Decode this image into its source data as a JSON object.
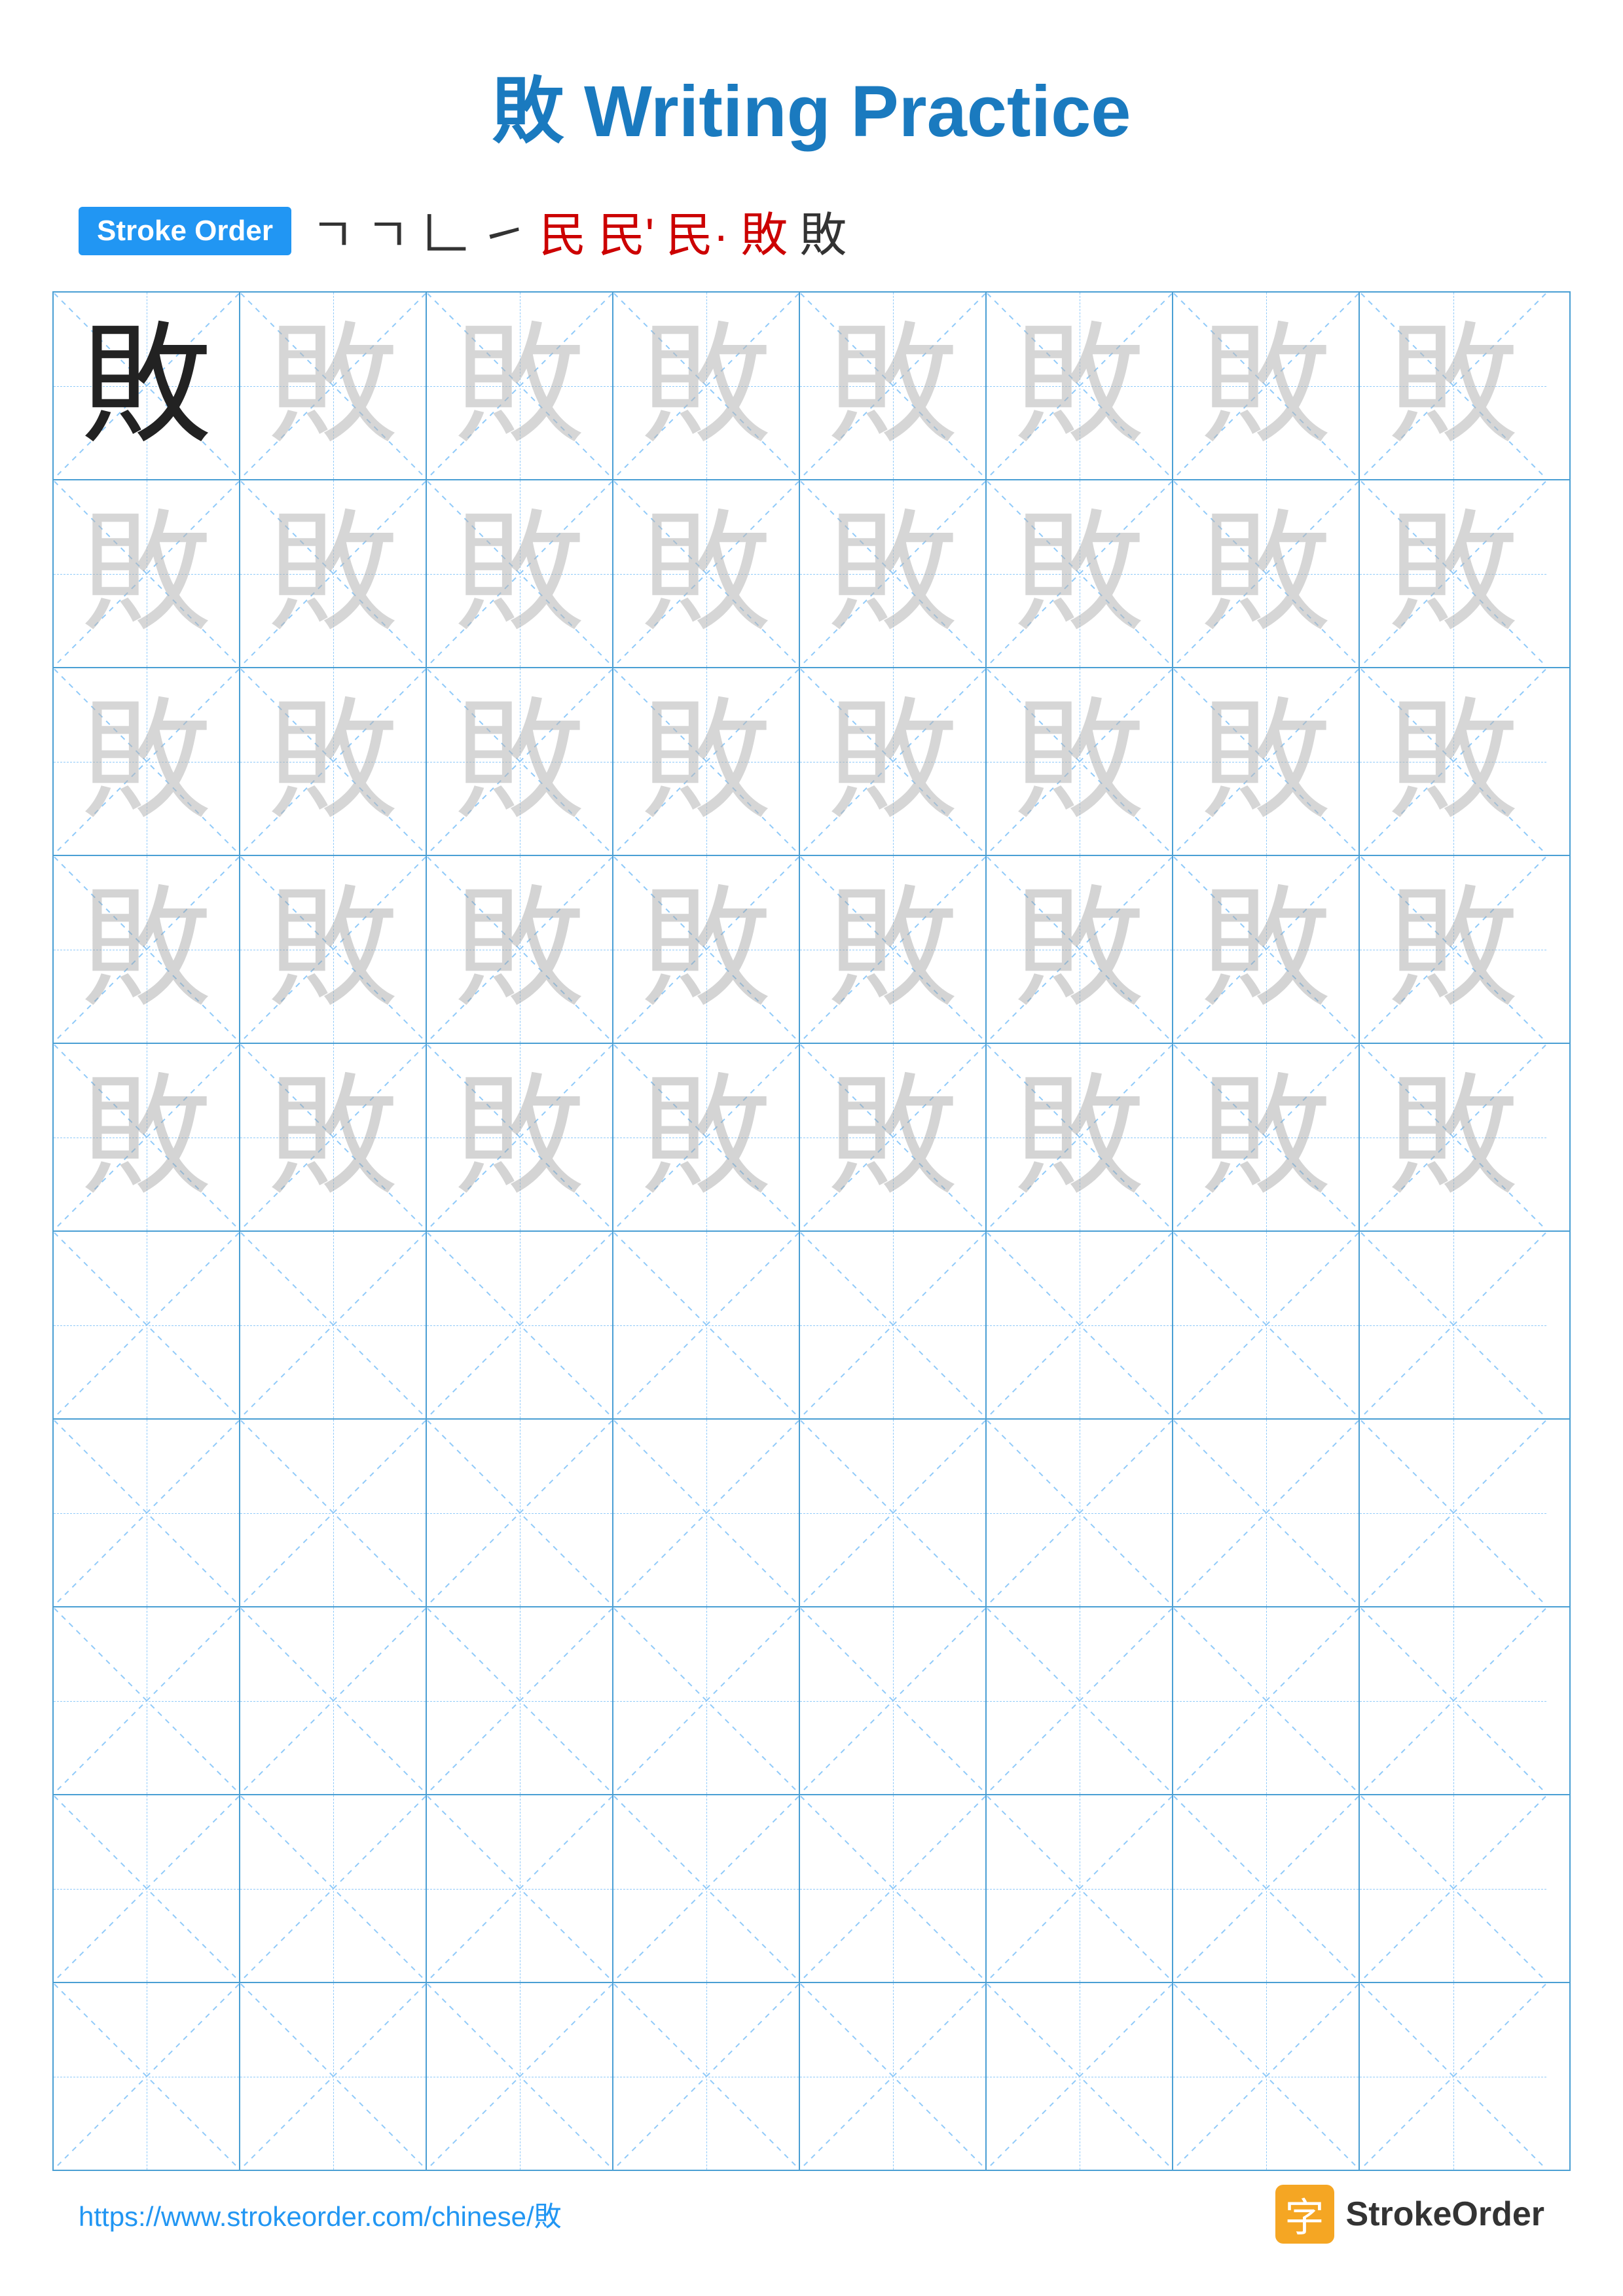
{
  "page": {
    "title": "敗 Writing Practice",
    "title_char": "敗",
    "title_text": " Writing Practice"
  },
  "stroke_order": {
    "badge_label": "Stroke Order",
    "strokes": [
      "⺃",
      "⺄",
      "𠃌",
      "㇣",
      "民",
      "民'",
      "民·",
      "敗",
      "敗"
    ]
  },
  "grid": {
    "rows": 10,
    "cols": 8,
    "char": "敗"
  },
  "footer": {
    "url": "https://www.strokeorder.com/chinese/敗",
    "logo_char": "字",
    "logo_text": "StrokeOrder"
  }
}
